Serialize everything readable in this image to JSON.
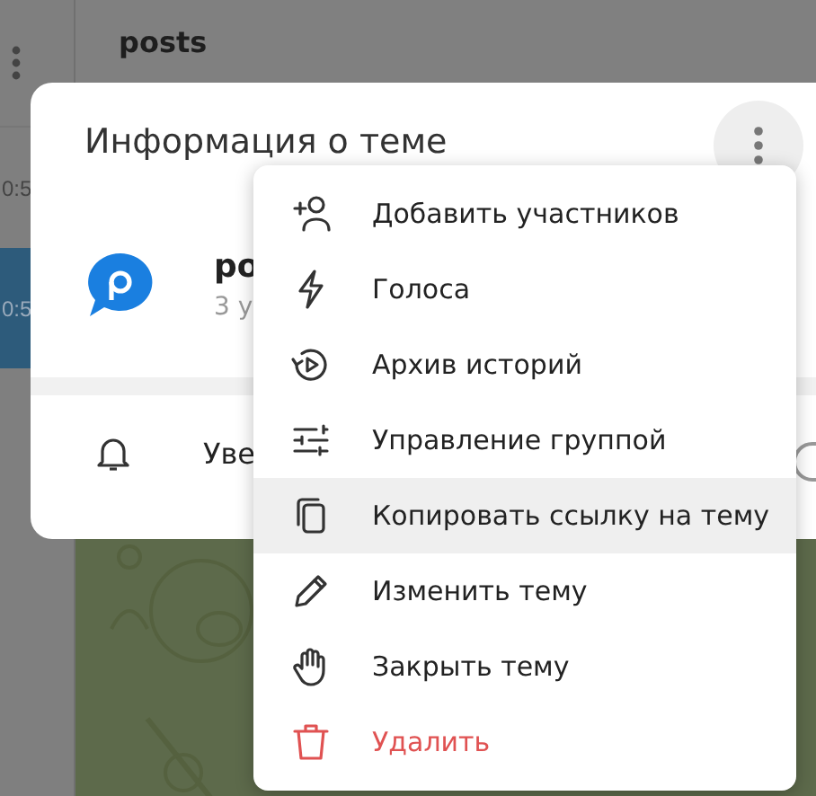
{
  "sidebar": {
    "items": [
      {
        "time": "0:5",
        "selected": false
      },
      {
        "time": "0:5",
        "selected": true
      }
    ]
  },
  "chat": {
    "title": "posts"
  },
  "dialog": {
    "title": "Информация о теме",
    "topic": {
      "name": "po",
      "subtitle": "3 у"
    },
    "notifications": {
      "label": "Уве",
      "on": false
    }
  },
  "menu": {
    "items": [
      {
        "label": "Добавить участников",
        "kind": "add-user",
        "danger": false,
        "selected": false
      },
      {
        "label": "Голоса",
        "kind": "bolt",
        "danger": false,
        "selected": false
      },
      {
        "label": "Архив историй",
        "kind": "story-archive",
        "danger": false,
        "selected": false
      },
      {
        "label": "Управление группой",
        "kind": "sliders",
        "danger": false,
        "selected": false
      },
      {
        "label": "Копировать ссылку на тему",
        "kind": "copy",
        "danger": false,
        "selected": true
      },
      {
        "label": "Изменить тему",
        "kind": "pencil",
        "danger": false,
        "selected": false
      },
      {
        "label": "Закрыть тему",
        "kind": "hand",
        "danger": false,
        "selected": false
      },
      {
        "label": "Удалить",
        "kind": "trash",
        "danger": true,
        "selected": false
      }
    ]
  }
}
